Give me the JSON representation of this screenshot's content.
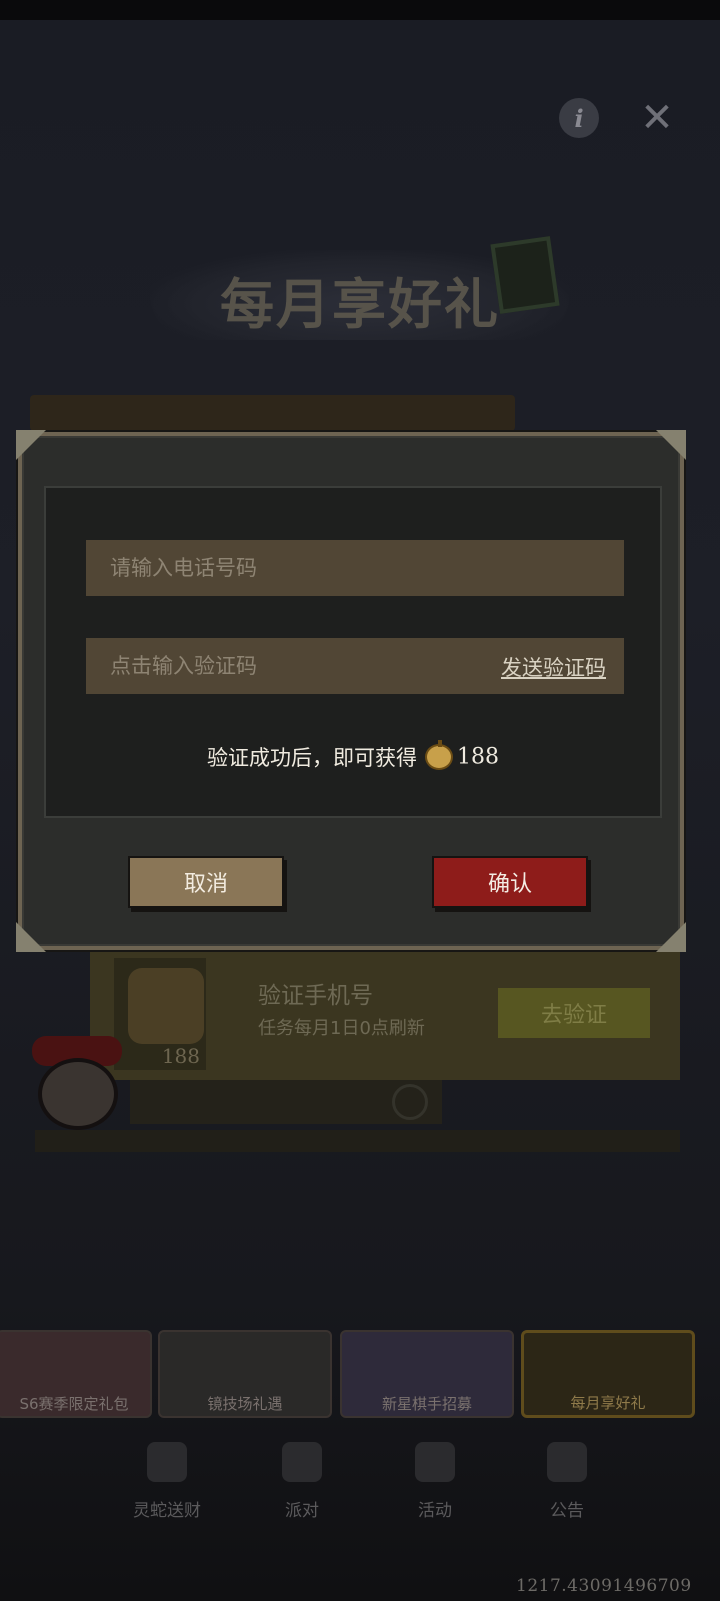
{
  "header": {
    "info_icon": "info-icon",
    "close_icon": "close-icon"
  },
  "banner": {
    "title": "每月享好礼"
  },
  "task": {
    "title": "验证手机号",
    "subtitle": "任务每月1日0点刷新",
    "reward_amount": "188",
    "button_label": "去验证"
  },
  "modal": {
    "phone_placeholder": "请输入电话号码",
    "code_placeholder": "点击输入验证码",
    "send_code_label": "发送验证码",
    "reward_text": "验证成功后，即可获得",
    "reward_icon": "pumpkin-coin-icon",
    "reward_amount": "188",
    "cancel_label": "取消",
    "confirm_label": "确认"
  },
  "tabs": [
    {
      "label": "S6赛季限定礼包"
    },
    {
      "label": "镜技场礼遇"
    },
    {
      "label": "新星棋手招募"
    },
    {
      "label": "每月享好礼"
    }
  ],
  "bottom_nav": [
    {
      "label": "灵蛇送财",
      "icon": "snake-icon"
    },
    {
      "label": "派对",
      "icon": "cake-icon"
    },
    {
      "label": "活动",
      "icon": "party-popper-icon"
    },
    {
      "label": "公告",
      "icon": "notice-icon"
    }
  ],
  "coordinate_readout": "1217.43091496709",
  "colors": {
    "modal_border": "#6e6452",
    "field_bg": "#514635",
    "cancel_bg": "#8a7657",
    "confirm_bg": "#8e1c1a"
  }
}
